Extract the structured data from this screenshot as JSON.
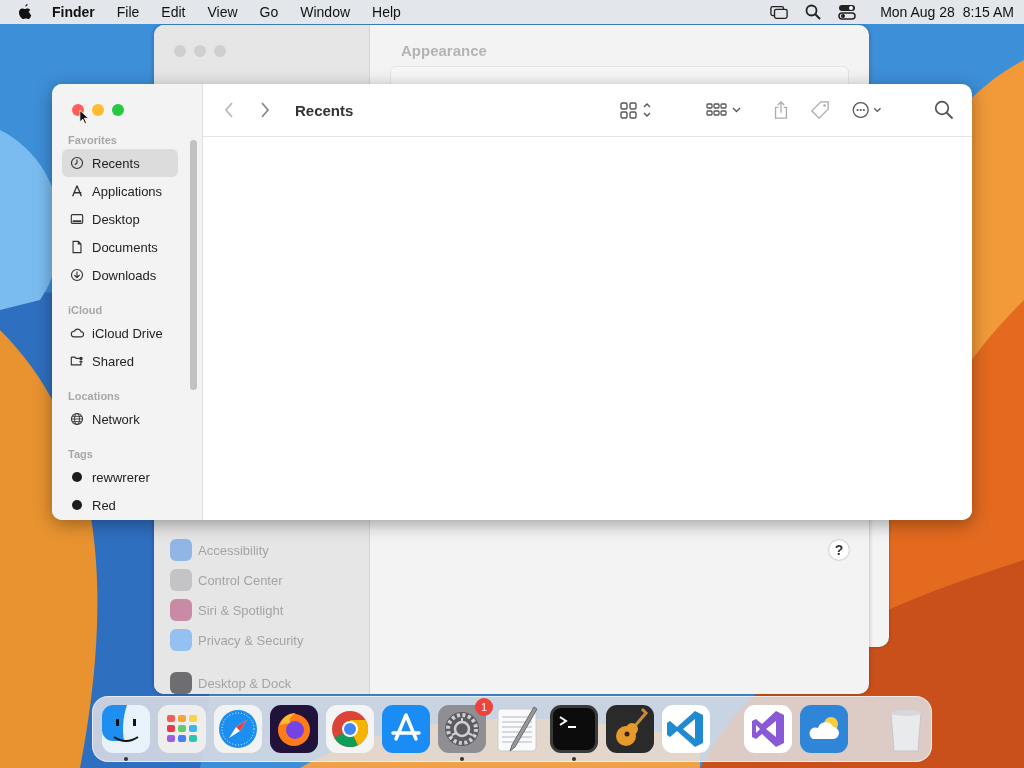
{
  "menu_bar": {
    "app": "Finder",
    "menus": [
      "File",
      "Edit",
      "View",
      "Go",
      "Window",
      "Help"
    ],
    "clock": "Mon Aug 28  8:15 AM"
  },
  "settings_window": {
    "title": "Appearance",
    "sidebar_items": [
      {
        "label": "Accessibility",
        "color": "#8fb6e6"
      },
      {
        "label": "Control Center",
        "color": "#c4c4c6"
      },
      {
        "label": "Siri & Spotlight",
        "color": "#c98aa6"
      },
      {
        "label": "Privacy & Security",
        "color": "#94c0f2"
      },
      {
        "label": "Desktop & Dock",
        "color": "#6e6e70"
      }
    ],
    "help": "?"
  },
  "finder": {
    "title": "Recents",
    "sections": [
      {
        "heading": "Favorites",
        "items": [
          {
            "label": "Recents",
            "kind": "clock",
            "selected": true
          },
          {
            "label": "Applications",
            "kind": "apps",
            "selected": false
          },
          {
            "label": "Desktop",
            "kind": "desktop",
            "selected": false
          },
          {
            "label": "Documents",
            "kind": "doc",
            "selected": false
          },
          {
            "label": "Downloads",
            "kind": "download",
            "selected": false
          }
        ]
      },
      {
        "heading": "iCloud",
        "items": [
          {
            "label": "iCloud Drive",
            "kind": "cloud",
            "selected": false
          },
          {
            "label": "Shared",
            "kind": "shared",
            "selected": false
          }
        ]
      },
      {
        "heading": "Locations",
        "items": [
          {
            "label": "Network",
            "kind": "globe",
            "selected": false
          }
        ]
      },
      {
        "heading": "Tags",
        "items": [
          {
            "label": "rewwrerer",
            "kind": "tag",
            "color": "#1c1c1e",
            "selected": false
          },
          {
            "label": "Red",
            "kind": "tag",
            "color": "#1c1c1e",
            "selected": false
          }
        ]
      }
    ]
  },
  "dock": {
    "apps": [
      {
        "kind": "finder",
        "running": true
      },
      {
        "kind": "launchpad",
        "running": false
      },
      {
        "kind": "safari",
        "running": false
      },
      {
        "kind": "firefox",
        "running": false
      },
      {
        "kind": "chrome",
        "running": false
      },
      {
        "kind": "appstore",
        "running": false
      },
      {
        "kind": "settings",
        "running": true,
        "badge": "1"
      },
      {
        "kind": "textedit",
        "running": false
      },
      {
        "kind": "terminal",
        "running": true
      },
      {
        "kind": "garageband",
        "running": false
      },
      {
        "kind": "vscode",
        "running": false
      },
      {
        "kind": "separator"
      },
      {
        "kind": "visualstudio",
        "running": false
      },
      {
        "kind": "weather",
        "running": false
      },
      {
        "kind": "separator"
      },
      {
        "kind": "trash",
        "running": false
      }
    ]
  }
}
